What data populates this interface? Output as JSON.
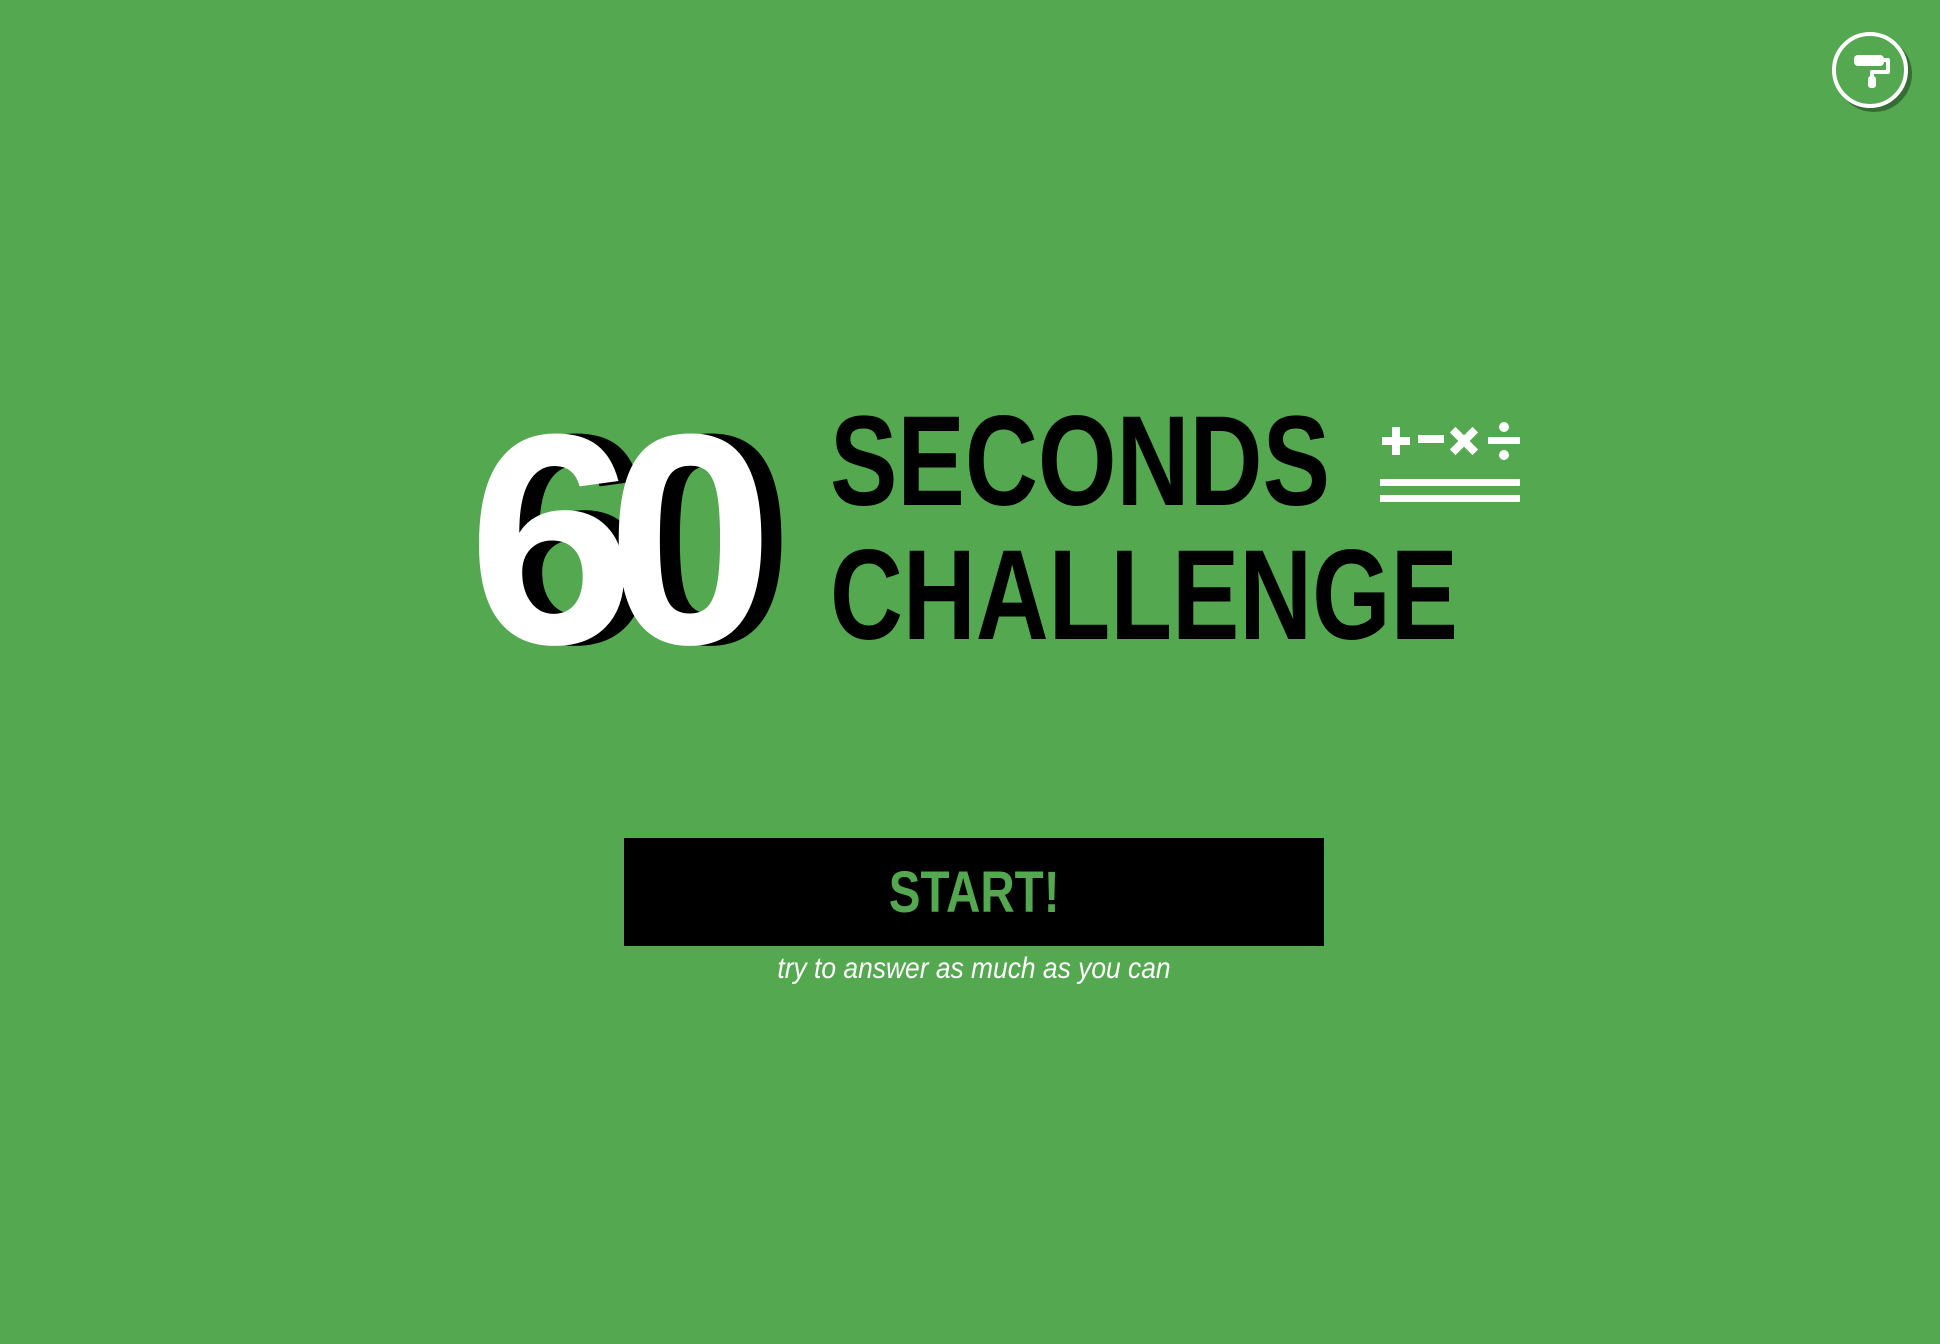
{
  "theme": {
    "background": "#54a850",
    "accent": "#54a850",
    "ink": "#000000",
    "light": "#ffffff"
  },
  "header": {
    "theme_button_icon": "paint-roller-icon"
  },
  "logo": {
    "number": "60",
    "line1": "SECONDS",
    "line2": "CHALLENGE",
    "operators": [
      "+",
      "−",
      "×",
      "÷"
    ]
  },
  "start": {
    "label": "START!",
    "hint": "try to answer as much as you can"
  }
}
